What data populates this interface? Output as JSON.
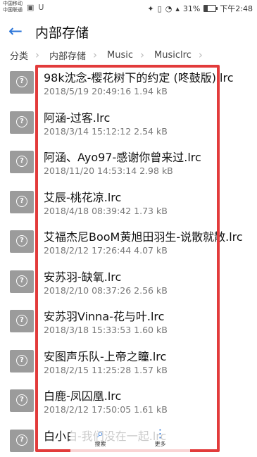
{
  "status": {
    "carrier_line1": "中国移动",
    "carrier_line2": "中国联通",
    "battery": "31%",
    "time": "下午2:48"
  },
  "appbar": {
    "title": "内部存储"
  },
  "breadcrumb": [
    "分类",
    "内部存储",
    "Music",
    "Musiclrc"
  ],
  "files": [
    {
      "name": "98k沈念-樱花树下的约定 (咚鼓版).lrc",
      "meta": "2018/5/19 20:49:16 1.94 kB"
    },
    {
      "name": "阿涵-过客.lrc",
      "meta": "2018/3/14 15:12:12 2.54 kB"
    },
    {
      "name": "阿涵、Ayo97-感谢你曾来过.lrc",
      "meta": "2018/11/20 14:53:14 2.98 kB"
    },
    {
      "name": "艾辰-桃花凉.lrc",
      "meta": "2018/4/18 08:39:42 1.73 kB"
    },
    {
      "name": "艾福杰尼BooM黄旭田羽生-说散就散.lrc",
      "meta": "2018/2/12 17:26:44 4.07 kB"
    },
    {
      "name": "安苏羽-缺氧.lrc",
      "meta": "2018/2/10 08:37:26 2.56 kB"
    },
    {
      "name": "安苏羽Vinna-花与叶.lrc",
      "meta": "2018/3/18 15:33:53 1.60 kB"
    },
    {
      "name": "安图声乐队-上帝之瞳.lrc",
      "meta": "2018/2/15 11:25:28 1.57 kB"
    },
    {
      "name": "白鹿-凤囚凰.lrc",
      "meta": "2018/2/12 17:50:05 1.61 kB"
    },
    {
      "name": "白小白-我们没在一起.lrc",
      "meta": ""
    }
  ],
  "bottomnav": {
    "search_label": "搜索",
    "more_label": "更多"
  },
  "colors": {
    "accent": "#2a74d8",
    "annotation": "#e23b3b",
    "file_icon": "#9b9b9b"
  }
}
